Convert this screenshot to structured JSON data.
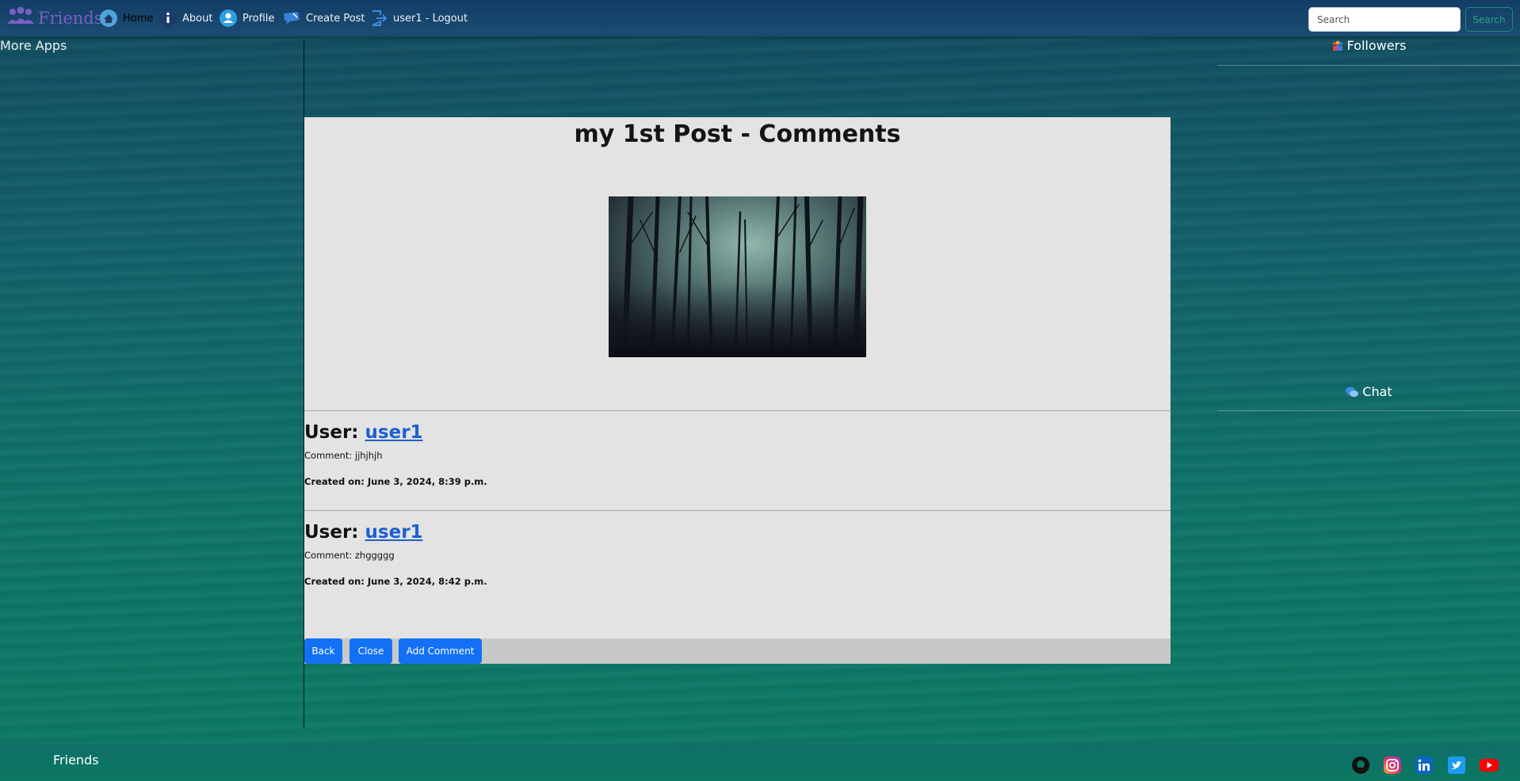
{
  "nav": {
    "brand": "Friends",
    "items": [
      {
        "label": "Home",
        "icon": "home-icon",
        "active": true
      },
      {
        "label": "About",
        "icon": "info-icon"
      },
      {
        "label": "Profile",
        "icon": "profile-icon"
      },
      {
        "label": "Create Post",
        "icon": "create-post-icon"
      },
      {
        "label": "user1 - Logout",
        "icon": "logout-icon"
      }
    ],
    "search_placeholder": "Search",
    "search_button": "Search"
  },
  "left_sidebar": {
    "title": "More Apps"
  },
  "right_sidebar": {
    "followers": "Followers",
    "chat": "Chat"
  },
  "post": {
    "title": "my 1st Post - Comments",
    "comments": [
      {
        "user_prefix": "User:",
        "user": "user1",
        "comment": "Comment: jjhjhjh",
        "created": "Created on: June 3, 2024, 8:39 p.m."
      },
      {
        "user_prefix": "User:",
        "user": "user1",
        "comment": "Comment: zhggggg",
        "created": "Created on: June 3, 2024, 8:42 p.m."
      }
    ],
    "buttons": {
      "back": "Back",
      "close": "Close",
      "add_comment": "Add Comment"
    }
  },
  "footer": {
    "brand": "Friends",
    "social": [
      "github-icon",
      "instagram-icon",
      "linkedin-icon",
      "twitter-icon",
      "youtube-icon"
    ]
  },
  "colors": {
    "accent": "#1270f5",
    "link": "#1d5fd0",
    "navbar": "#1b4c72",
    "card": "#e3e3e3"
  }
}
